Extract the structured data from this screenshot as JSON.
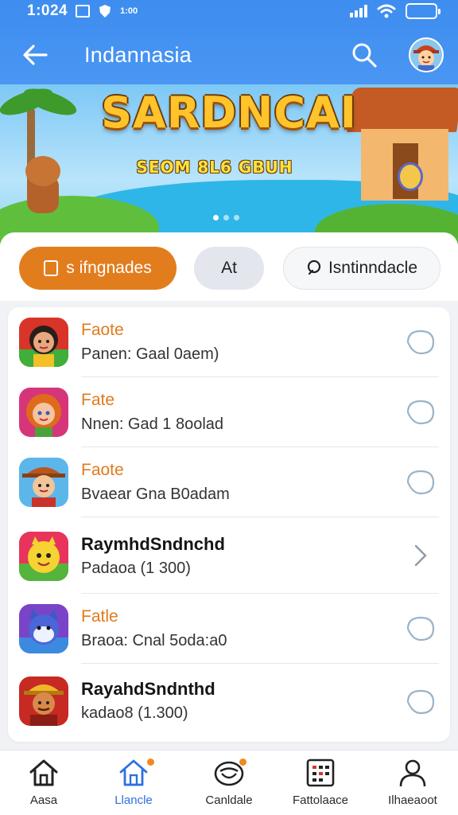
{
  "status_bar": {
    "time": "1:024",
    "mini_text": "1:00"
  },
  "header": {
    "title": "Indannasia"
  },
  "banner": {
    "title": "SARDNCAI",
    "subtitle": "SEOM 8L6 GBUH"
  },
  "tabs": [
    {
      "label": "s ifngnades",
      "active": true
    },
    {
      "label": "At",
      "active": false
    },
    {
      "label": "Isntinndacle",
      "active": false
    }
  ],
  "list": [
    {
      "title": "Faote",
      "subtitle": "Panen: Gaal 0aem)",
      "title_style": "accent",
      "action": "circle",
      "icon": "girl-avatar-icon"
    },
    {
      "title": "Fate",
      "subtitle": "Nnen: Gad 1 8oolad",
      "title_style": "accent",
      "action": "circle",
      "icon": "redhead-avatar-icon"
    },
    {
      "title": "Faote",
      "subtitle": "Bvaear Gna B0adam",
      "title_style": "accent",
      "action": "circle",
      "icon": "cowboy-avatar-icon"
    },
    {
      "title": "RaymhdSndnchd",
      "subtitle": "Padaoa (1 300)",
      "title_style": "bold",
      "action": "chevron",
      "icon": "yellow-creature-icon"
    },
    {
      "title": "Fatle",
      "subtitle": "Braoa: Cnal 5oda:a0",
      "title_style": "accent",
      "action": "circle",
      "icon": "blue-cat-icon"
    },
    {
      "title": "RayahdSndnthd",
      "subtitle": "kadao8 (1.300)",
      "title_style": "bold",
      "action": "circle",
      "icon": "warrior-avatar-icon"
    }
  ],
  "bottom_nav": [
    {
      "label": "Aasa",
      "icon": "home-icon",
      "active": false,
      "badge": false
    },
    {
      "label": "Llancle",
      "icon": "home-outline-icon",
      "active": true,
      "badge": true
    },
    {
      "label": "Canldale",
      "icon": "smile-icon",
      "active": false,
      "badge": true
    },
    {
      "label": "Fattolaace",
      "icon": "calendar-icon",
      "active": false,
      "badge": false
    },
    {
      "label": "Ilhaeaoot",
      "icon": "profile-icon",
      "active": false,
      "badge": false
    }
  ],
  "colors": {
    "header_bg": "#3d8df0",
    "accent_orange": "#e27d1e",
    "nav_active": "#2f6fe0"
  }
}
